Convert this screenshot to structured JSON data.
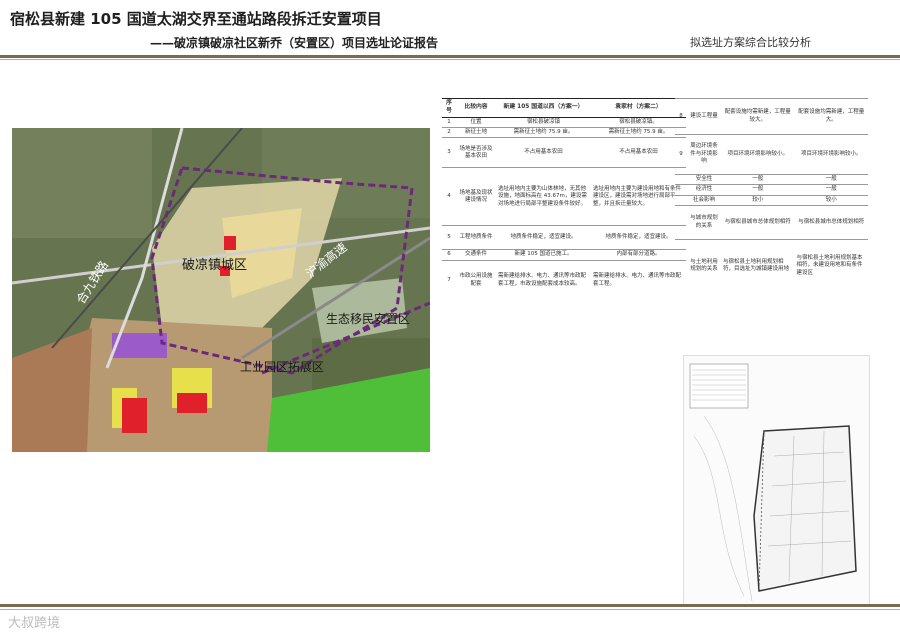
{
  "header": {
    "title": "宿松县新建 105 国道太湖交界至通站路段拆迁安置项目",
    "subtitle": "——破凉镇破凉社区新乔（安置区）项目选址论证报告",
    "right_label": "拟选址方案综合比较分析"
  },
  "map": {
    "labels": {
      "town": "破凉镇城区",
      "eco": "生态移民安置区",
      "industrial": "工业园区拓展区",
      "railway": "合九铁路",
      "highway": "沪渝高速"
    }
  },
  "table_left": {
    "headers": [
      "序号",
      "比较内容",
      "新建 105 国道以西（方案一）",
      "袁家村（方案二）"
    ],
    "rows": [
      [
        "1",
        "位置",
        "宿松县破凉镇",
        "宿松县破凉镇。"
      ],
      [
        "2",
        "新征土地",
        "需新征土地约 75.9 亩。",
        "需新征土地约 75.9 亩。"
      ],
      [
        "3",
        "场地是否涉及基本农田",
        "不占用基本农田",
        "不占用基本农田"
      ],
      [
        "4",
        "场地基及现状建设情况",
        "选址用地内主要为山体林地，无其他设施，地面标高在 43.67m，建设需对场地进行局部平整建设条件较好。",
        "选址用地内主要为建设用地和有条件建设区，建设需对场地进行局部平整，并且拆迁量较大。"
      ],
      [
        "5",
        "工程地质条件",
        "地质条件稳定，适宜建设。",
        "地质条件稳定，适宜建设。"
      ],
      [
        "6",
        "交通条件",
        "新建 105 国道已施工。",
        "内部有部分道路。"
      ],
      [
        "7",
        "市政公用设施配套",
        "需新建给排水、电力、通讯等市政配套工程，市政设施配套成本较高。",
        "需新建给排水、电力、通讯等市政配套工程。"
      ]
    ]
  },
  "table_right": {
    "rows": [
      [
        "8",
        "建设工程量",
        "配套设施均需新建，工程量较大。",
        "配套设施均需新建，工程量大。"
      ],
      [
        "9",
        "周边环境条件与环境影响",
        "项目环境环境影响较小。",
        "项目环境环境影响较小。"
      ],
      [
        "",
        "安全性",
        "一般",
        "一般"
      ],
      [
        "",
        "经济性",
        "一般",
        "一般"
      ],
      [
        "",
        "社会影响",
        "较小",
        "较小"
      ],
      [
        "",
        "与城市规划的关系",
        "与宿松县城市总体规划相符",
        "与宿松县城市总体规划相符"
      ],
      [
        "",
        "与土地利用规划的关系",
        "与宿松县土地利用规划相符，目选址为城镇建设用地",
        "与宿松县土地利用规划基本相符，未建设用地和有条件建设区"
      ]
    ]
  },
  "watermark": "大叔跨境",
  "colors": {
    "rule": "#7a6a52",
    "boundary": "#6b2a78",
    "highlight_red": "#e0202a"
  }
}
